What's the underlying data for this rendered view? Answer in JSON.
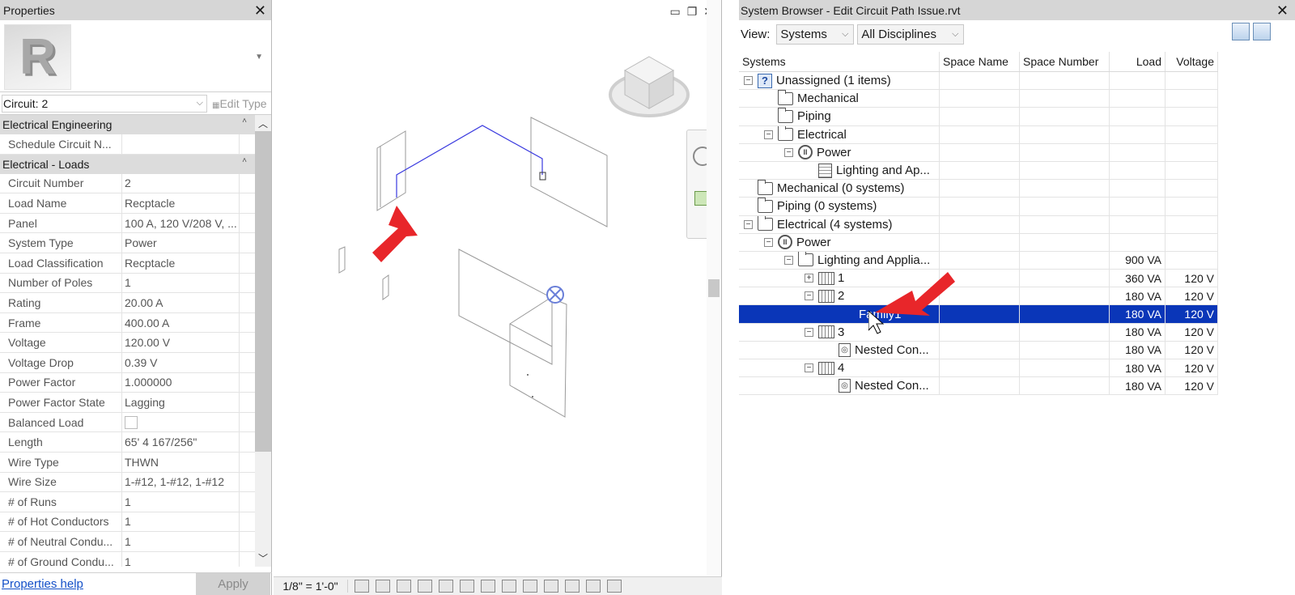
{
  "properties": {
    "title": "Properties",
    "logo_letter": "R",
    "selector_value": "Circuit: 2",
    "edit_type_label": "Edit Type",
    "groups": [
      {
        "name": "Electrical Engineering",
        "rows": [
          {
            "name": "Schedule Circuit N...",
            "value": ""
          }
        ]
      },
      {
        "name": "Electrical - Loads",
        "rows": [
          {
            "name": "Circuit Number",
            "value": "2"
          },
          {
            "name": "Load Name",
            "value": "Recptacle"
          },
          {
            "name": "Panel",
            "value": "100 A, 120 V/208 V, ..."
          },
          {
            "name": "System Type",
            "value": "Power"
          },
          {
            "name": "Load Classification",
            "value": "Recptacle"
          },
          {
            "name": "Number of Poles",
            "value": "1"
          },
          {
            "name": "Rating",
            "value": "20.00 A"
          },
          {
            "name": "Frame",
            "value": "400.00 A"
          },
          {
            "name": "Voltage",
            "value": "120.00 V"
          },
          {
            "name": "Voltage Drop",
            "value": "0.39 V"
          },
          {
            "name": "Power Factor",
            "value": "1.000000"
          },
          {
            "name": "Power Factor State",
            "value": "Lagging"
          },
          {
            "name": "Balanced Load",
            "value": "",
            "checkbox": true
          },
          {
            "name": "Length",
            "value": "65'  4 167/256\""
          },
          {
            "name": "Wire Type",
            "value": "THWN"
          },
          {
            "name": "Wire Size",
            "value": "1-#12, 1-#12, 1-#12"
          },
          {
            "name": "# of Runs",
            "value": "1"
          },
          {
            "name": "# of Hot Conductors",
            "value": "1"
          },
          {
            "name": "# of Neutral Condu...",
            "value": "1"
          },
          {
            "name": "# of Ground Condu...",
            "value": "1"
          }
        ]
      }
    ],
    "help_link": "Properties help",
    "apply_label": "Apply"
  },
  "viewport": {
    "scale": "1/8\" = 1'-0\""
  },
  "system_browser": {
    "title": "System Browser - Edit Circuit Path Issue.rvt",
    "view_label": "View:",
    "view_value": "Systems",
    "discipline_value": "All Disciplines",
    "columns": [
      "Systems",
      "Space Name",
      "Space Number",
      "Load",
      "Voltage"
    ],
    "rows": [
      {
        "indent": 0,
        "toggle": "−",
        "icon": "question",
        "label": "Unassigned (1 items)",
        "load": "",
        "voltage": ""
      },
      {
        "indent": 1,
        "toggle": "",
        "icon": "folder",
        "label": "Mechanical",
        "load": "",
        "voltage": ""
      },
      {
        "indent": 1,
        "toggle": "",
        "icon": "folder",
        "label": "Piping",
        "load": "",
        "voltage": ""
      },
      {
        "indent": 1,
        "toggle": "−",
        "icon": "folder",
        "label": "Electrical",
        "load": "",
        "voltage": ""
      },
      {
        "indent": 2,
        "toggle": "−",
        "icon": "power",
        "label": "Power",
        "load": "",
        "voltage": ""
      },
      {
        "indent": 3,
        "toggle": "",
        "icon": "panel",
        "label": "Lighting and Ap...",
        "load": "",
        "voltage": ""
      },
      {
        "indent": 0,
        "toggle": "",
        "icon": "folder",
        "label": "Mechanical (0 systems)",
        "load": "",
        "voltage": ""
      },
      {
        "indent": 0,
        "toggle": "",
        "icon": "folder",
        "label": "Piping (0 systems)",
        "load": "",
        "voltage": ""
      },
      {
        "indent": 0,
        "toggle": "−",
        "icon": "folder",
        "label": "Electrical (4 systems)",
        "load": "",
        "voltage": ""
      },
      {
        "indent": 1,
        "toggle": "−",
        "icon": "power",
        "label": "Power",
        "load": "",
        "voltage": ""
      },
      {
        "indent": 2,
        "toggle": "−",
        "icon": "folder",
        "label": "Lighting and Applia...",
        "load": "900 VA",
        "voltage": ""
      },
      {
        "indent": 3,
        "toggle": "+",
        "icon": "circuit",
        "label": "1",
        "load": "360 VA",
        "voltage": "120 V"
      },
      {
        "indent": 3,
        "toggle": "−",
        "icon": "circuit",
        "label": "2",
        "load": "180 VA",
        "voltage": "120 V"
      },
      {
        "indent": 5,
        "toggle": "",
        "icon": "none",
        "label": "Family1",
        "load": "180 VA",
        "voltage": "120 V",
        "selected": true
      },
      {
        "indent": 3,
        "toggle": "−",
        "icon": "circuit",
        "label": "3",
        "load": "180 VA",
        "voltage": "120 V"
      },
      {
        "indent": 4,
        "toggle": "",
        "icon": "device",
        "label": "Nested Con...",
        "load": "180 VA",
        "voltage": "120 V"
      },
      {
        "indent": 3,
        "toggle": "−",
        "icon": "circuit",
        "label": "4",
        "load": "180 VA",
        "voltage": "120 V"
      },
      {
        "indent": 4,
        "toggle": "",
        "icon": "device",
        "label": "Nested Con...",
        "load": "180 VA",
        "voltage": "120 V"
      }
    ]
  },
  "colors": {
    "selection": "#0a36b8",
    "circuit_wire": "#3a3adf",
    "annotation_arrow": "#e8262a"
  }
}
